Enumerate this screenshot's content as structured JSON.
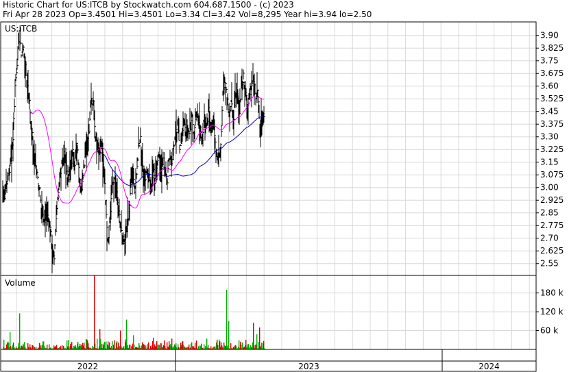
{
  "header": {
    "line1": "Historic Chart for US:ITCB by Stockwatch.com 604.687.1500 - (c) 2023",
    "line2": "Fri Apr 28 2023   Op=3.4501   Hi=3.4501   Lo=3.34   Cl=3.42   Vol=8,295   Year hi=3.94   lo=2.50"
  },
  "chart_data": {
    "type": "line",
    "symbol": "US:ITCB",
    "price_panel": {
      "label": "US:ITCB",
      "ylim": [
        2.48,
        3.98
      ],
      "yticks": [
        3.9,
        3.825,
        3.75,
        3.675,
        3.6,
        3.525,
        3.45,
        3.375,
        3.3,
        3.225,
        3.15,
        3.075,
        3.0,
        2.925,
        2.85,
        2.775,
        2.7,
        2.625,
        2.55
      ],
      "ytick_labels": [
        "3.90",
        "3.825",
        "3.75",
        "3.675",
        "3.60",
        "3.525",
        "3.45",
        "3.375",
        "3.30",
        "3.225",
        "3.15",
        "3.075",
        "3.00",
        "2.925",
        "2.85",
        "2.775",
        "2.70",
        "2.625",
        "2.55"
      ],
      "grid": true,
      "series_color": "#000000",
      "ma_fast_color": "#ff00ff",
      "ma_slow_color": "#0000cc",
      "anchors": [
        [
          0,
          3.0
        ],
        [
          3,
          2.95
        ],
        [
          6,
          3.05
        ],
        [
          9,
          3.08
        ],
        [
          12,
          3.15
        ],
        [
          15,
          3.3
        ],
        [
          18,
          3.6
        ],
        [
          21,
          3.75
        ],
        [
          24,
          3.88
        ],
        [
          27,
          3.8
        ],
        [
          30,
          3.82
        ],
        [
          33,
          3.7
        ],
        [
          36,
          3.6
        ],
        [
          39,
          3.5
        ],
        [
          42,
          3.35
        ],
        [
          45,
          3.2
        ],
        [
          48,
          3.12
        ],
        [
          51,
          3.05
        ],
        [
          54,
          3.0
        ],
        [
          57,
          2.85
        ],
        [
          60,
          2.78
        ],
        [
          63,
          2.85
        ],
        [
          66,
          2.8
        ],
        [
          69,
          2.78
        ],
        [
          72,
          2.62
        ],
        [
          75,
          2.55
        ],
        [
          78,
          2.8
        ],
        [
          81,
          3.0
        ],
        [
          84,
          3.1
        ],
        [
          87,
          3.15
        ],
        [
          90,
          3.2
        ],
        [
          93,
          3.1
        ],
        [
          96,
          3.05
        ],
        [
          99,
          3.15
        ],
        [
          102,
          3.2
        ],
        [
          105,
          3.15
        ],
        [
          108,
          3.25
        ],
        [
          111,
          3.1
        ],
        [
          114,
          3.0
        ],
        [
          117,
          3.05
        ],
        [
          120,
          3.2
        ],
        [
          123,
          3.3
        ],
        [
          126,
          3.35
        ],
        [
          129,
          3.55
        ],
        [
          132,
          3.5
        ],
        [
          135,
          3.3
        ],
        [
          138,
          3.25
        ],
        [
          141,
          3.2
        ],
        [
          144,
          3.25
        ],
        [
          147,
          3.1
        ],
        [
          150,
          2.95
        ],
        [
          153,
          2.7
        ],
        [
          156,
          2.8
        ],
        [
          159,
          3.0
        ],
        [
          162,
          3.05
        ],
        [
          165,
          3.0
        ],
        [
          168,
          2.85
        ],
        [
          171,
          2.8
        ],
        [
          174,
          2.7
        ],
        [
          177,
          2.65
        ],
        [
          180,
          2.75
        ],
        [
          183,
          2.8
        ],
        [
          186,
          2.95
        ],
        [
          189,
          3.1
        ],
        [
          192,
          3.0
        ],
        [
          195,
          3.05
        ],
        [
          198,
          3.25
        ],
        [
          201,
          3.3
        ],
        [
          204,
          3.1
        ],
        [
          207,
          3.05
        ],
        [
          210,
          3.1
        ],
        [
          213,
          3.05
        ],
        [
          216,
          3.0
        ],
        [
          219,
          3.1
        ],
        [
          222,
          3.05
        ],
        [
          225,
          3.15
        ],
        [
          228,
          3.2
        ],
        [
          231,
          3.1
        ],
        [
          234,
          3.15
        ],
        [
          237,
          3.1
        ],
        [
          240,
          3.05
        ],
        [
          243,
          3.2
        ],
        [
          246,
          3.15
        ],
        [
          249,
          3.25
        ],
        [
          252,
          3.3
        ],
        [
          255,
          3.35
        ],
        [
          258,
          3.25
        ],
        [
          261,
          3.3
        ],
        [
          264,
          3.4
        ],
        [
          267,
          3.35
        ],
        [
          270,
          3.3
        ],
        [
          273,
          3.35
        ],
        [
          276,
          3.4
        ],
        [
          279,
          3.3
        ],
        [
          282,
          3.45
        ],
        [
          285,
          3.4
        ],
        [
          288,
          3.35
        ],
        [
          291,
          3.3
        ],
        [
          294,
          3.4
        ],
        [
          297,
          3.35
        ],
        [
          300,
          3.45
        ],
        [
          303,
          3.35
        ],
        [
          306,
          3.4
        ],
        [
          309,
          3.3
        ],
        [
          312,
          3.2
        ],
        [
          315,
          3.2
        ],
        [
          318,
          3.25
        ],
        [
          321,
          3.55
        ],
        [
          324,
          3.65
        ],
        [
          327,
          3.55
        ],
        [
          330,
          3.45
        ],
        [
          333,
          3.5
        ],
        [
          336,
          3.4
        ],
        [
          339,
          3.5
        ],
        [
          342,
          3.55
        ],
        [
          345,
          3.45
        ],
        [
          348,
          3.6
        ],
        [
          351,
          3.65
        ],
        [
          354,
          3.55
        ],
        [
          357,
          3.5
        ],
        [
          360,
          3.55
        ],
        [
          363,
          3.6
        ],
        [
          366,
          3.65
        ],
        [
          369,
          3.55
        ],
        [
          372,
          3.6
        ],
        [
          375,
          3.35
        ],
        [
          378,
          3.4
        ],
        [
          381,
          3.42
        ]
      ]
    },
    "volume_panel": {
      "label": "Volume",
      "ylim": [
        0,
        236000
      ],
      "yticks": [
        60000,
        120000,
        180000
      ],
      "ytick_labels": [
        "60 k",
        "120 k",
        "180 k"
      ],
      "up_color": "#00aa00",
      "down_color": "#dd0000",
      "spikes": [
        [
          133,
          235000,
          "down"
        ],
        [
          326,
          190000,
          "up"
        ],
        [
          24,
          115000,
          "up"
        ],
        [
          180,
          95000,
          "up"
        ],
        [
          329,
          90000,
          "up"
        ],
        [
          365,
          85000,
          "down"
        ],
        [
          374,
          70000,
          "down"
        ],
        [
          141,
          65000,
          "down"
        ],
        [
          171,
          60000,
          "down"
        ],
        [
          10,
          55000,
          "up"
        ],
        [
          190,
          45000,
          "up"
        ],
        [
          370,
          48000,
          "up"
        ]
      ]
    },
    "x_axis": {
      "labels": [
        "2022",
        "2023",
        "2024"
      ],
      "bounds": [
        0,
        256,
        645,
        782
      ]
    }
  }
}
